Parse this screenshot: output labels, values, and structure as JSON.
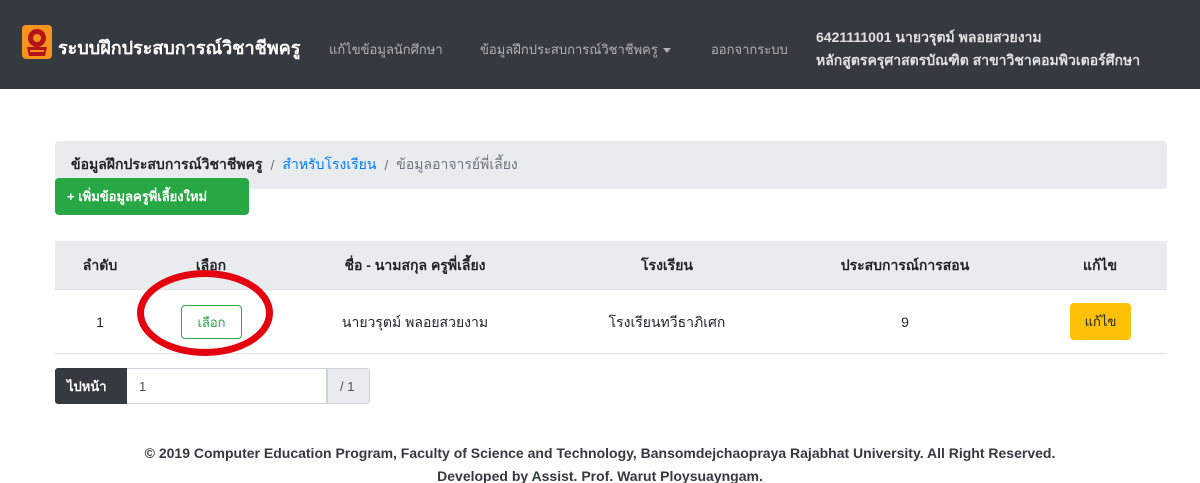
{
  "navbar": {
    "brand": "ระบบฝึกประสบการณ์วิชาชีพครู",
    "links": [
      "แก้ไขข้อมูลนักศึกษา",
      "ข้อมูลฝึกประสบการณ์วิชาชีพครู",
      "ออกจากระบบ"
    ],
    "user_line1": "6421111001 นายวรุตม์ พลอยสวยงาม",
    "user_line2": "หลักสูตรครุศาสตรบัณฑิต สาขาวิชาคอมพิวเตอร์ศึกษา"
  },
  "breadcrumb": {
    "root": "ข้อมูลฝึกประสบการณ์วิชาชีพครู",
    "link": "สำหรับโรงเรียน",
    "active": "ข้อมูลอาจารย์พี่เลี้ยง",
    "separator": "/"
  },
  "add_button": "+ เพิ่มข้อมูลครูพี่เลี้ยงใหม่",
  "table": {
    "headers": [
      "ลำดับ",
      "เลือก",
      "ชื่อ - นามสกุล ครูพี่เลี้ยง",
      "โรงเรียน",
      "ประสบการณ์การสอน",
      "แก้ไข"
    ],
    "rows": [
      {
        "no": "1",
        "select_label": "เลือก",
        "name": "นายวรุตม์ พลอยสวยงาม",
        "school": "โรงเรียนทวีธาภิเศก",
        "experience": "9",
        "edit_label": "แก้ไข"
      }
    ]
  },
  "pager": {
    "label": "ไปหน้า",
    "value": "1",
    "total": "/ 1"
  },
  "footer": {
    "line1": "© 2019 Computer Education Program, Faculty of Science and Technology, Bansomdejchaopraya Rajabhat University. All Right Reserved.",
    "line2": "Developed by Assist. Prof. Warut Ploysuayngam."
  },
  "colors": {
    "navbar": "#343a40",
    "success": "#28a745",
    "warning": "#ffc107",
    "link": "#007bff",
    "highlight_circle": "#e5000f"
  },
  "icons": {
    "logo": "university-seal-icon",
    "dropdown": "caret-down-icon"
  }
}
